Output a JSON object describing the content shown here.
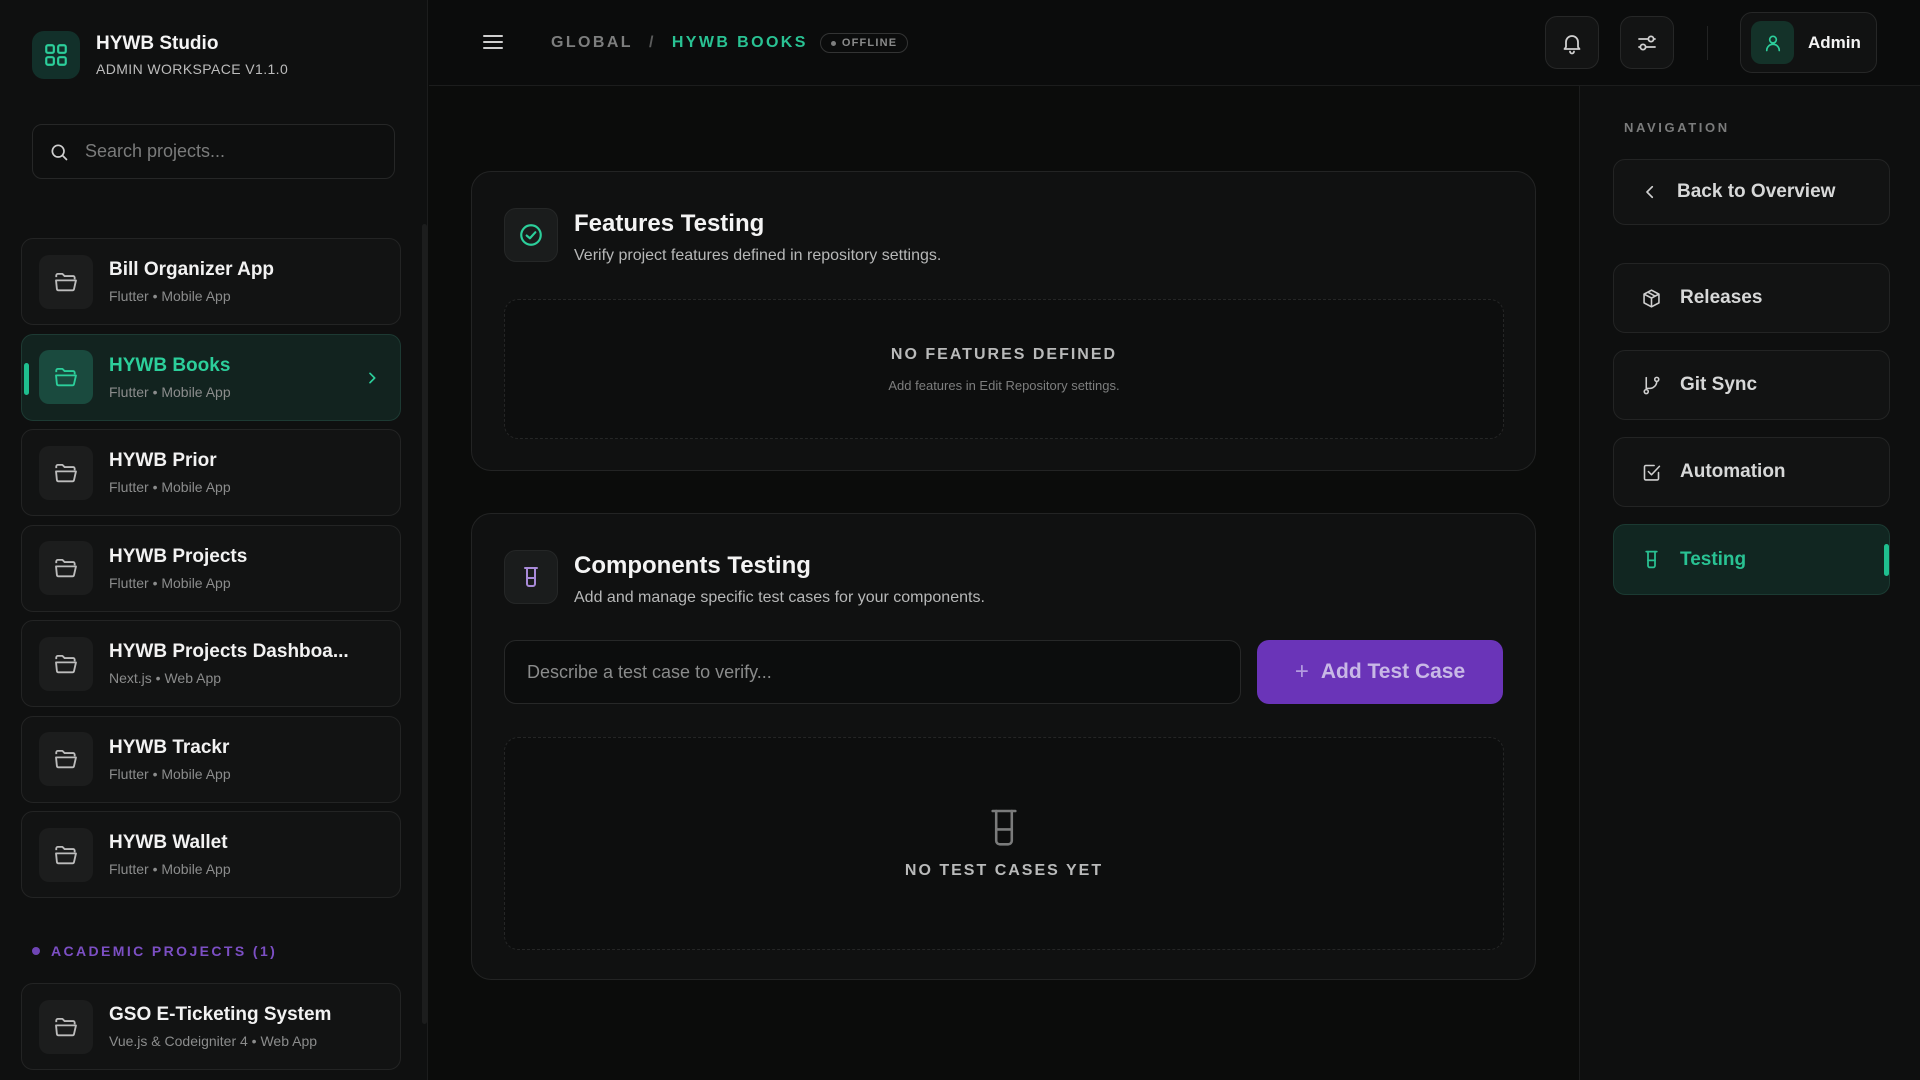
{
  "brand": {
    "title": "HYWB Studio",
    "subtitle": "ADMIN WORKSPACE V1.1.0"
  },
  "search": {
    "placeholder": "Search projects..."
  },
  "projects": [
    {
      "name": "Bill Organizer App",
      "meta": "Flutter • Mobile App",
      "active": false
    },
    {
      "name": "HYWB Books",
      "meta": "Flutter • Mobile App",
      "active": true
    },
    {
      "name": "HYWB Prior",
      "meta": "Flutter • Mobile App",
      "active": false
    },
    {
      "name": "HYWB Projects",
      "meta": "Flutter • Mobile App",
      "active": false
    },
    {
      "name": "HYWB Projects Dashboa...",
      "meta": "Next.js • Web App",
      "active": false
    },
    {
      "name": "HYWB Trackr",
      "meta": "Flutter • Mobile App",
      "active": false
    },
    {
      "name": "HYWB Wallet",
      "meta": "Flutter • Mobile App",
      "active": false
    }
  ],
  "academic": {
    "label": "ACADEMIC PROJECTS (1)",
    "projects": [
      {
        "name": "GSO E-Ticketing System",
        "meta": "Vue.js & Codeigniter 4 • Web App"
      }
    ]
  },
  "topbar": {
    "breadcrumb_root": "GLOBAL",
    "breadcrumb_sep": "/",
    "breadcrumb_current": "HYWB BOOKS",
    "status_badge": "OFFLINE",
    "user_name": "Admin"
  },
  "features": {
    "title": "Features Testing",
    "description": "Verify project features defined in repository settings.",
    "empty_title": "NO FEATURES DEFINED",
    "empty_sub": "Add features in Edit Repository settings."
  },
  "components": {
    "title": "Components Testing",
    "description": "Add and manage specific test cases for your components.",
    "input_placeholder": "Describe a test case to verify...",
    "add_button": "Add Test Case",
    "empty_title": "NO TEST CASES YET"
  },
  "navigation": {
    "label": "NAVIGATION",
    "back": "Back to Overview",
    "items": [
      {
        "label": "Releases",
        "icon": "package-icon"
      },
      {
        "label": "Git Sync",
        "icon": "git-branch-icon"
      },
      {
        "label": "Automation",
        "icon": "check-square-icon"
      },
      {
        "label": "Testing",
        "icon": "beaker-icon",
        "active": true
      }
    ]
  },
  "colors": {
    "accent": "#29c293",
    "purple": "#6a34b8",
    "background": "#0b0c0b"
  }
}
